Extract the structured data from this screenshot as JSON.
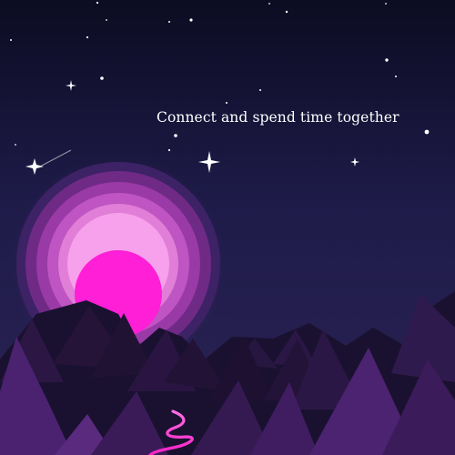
{
  "caption": "Connect and spend time together",
  "colors": {
    "sky_top": "#0c0c22",
    "sky_mid": "#1e1b49",
    "sky_bottom": "#2b2354",
    "sun_core": "#ff1fd6",
    "halo_1": "#f7a0eb",
    "halo_2": "#e07ed8",
    "halo_3": "#bf55c2",
    "halo_4": "#9a3aa6",
    "halo_5": "#6f2a86",
    "mountain_dark": "#150d26",
    "mountain_mid": "#2c1644",
    "mountain_light": "#5a2a7e",
    "path": "#ff2fcf",
    "star": "#ffffff"
  },
  "icons": [
    "sparkle-star-icon",
    "shooting-star-icon",
    "sun-icon",
    "mountain-range",
    "winding-path"
  ]
}
